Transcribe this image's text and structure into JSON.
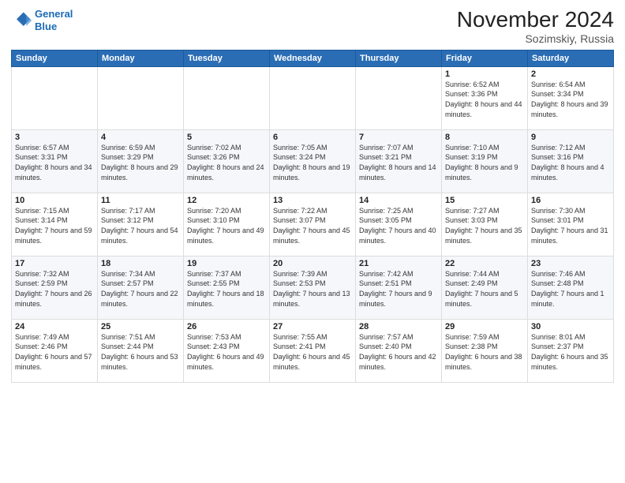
{
  "header": {
    "logo_line1": "General",
    "logo_line2": "Blue",
    "month_title": "November 2024",
    "subtitle": "Sozimskiy, Russia"
  },
  "weekdays": [
    "Sunday",
    "Monday",
    "Tuesday",
    "Wednesday",
    "Thursday",
    "Friday",
    "Saturday"
  ],
  "weeks": [
    [
      {
        "day": "",
        "info": ""
      },
      {
        "day": "",
        "info": ""
      },
      {
        "day": "",
        "info": ""
      },
      {
        "day": "",
        "info": ""
      },
      {
        "day": "",
        "info": ""
      },
      {
        "day": "1",
        "info": "Sunrise: 6:52 AM\nSunset: 3:36 PM\nDaylight: 8 hours and 44 minutes."
      },
      {
        "day": "2",
        "info": "Sunrise: 6:54 AM\nSunset: 3:34 PM\nDaylight: 8 hours and 39 minutes."
      }
    ],
    [
      {
        "day": "3",
        "info": "Sunrise: 6:57 AM\nSunset: 3:31 PM\nDaylight: 8 hours and 34 minutes."
      },
      {
        "day": "4",
        "info": "Sunrise: 6:59 AM\nSunset: 3:29 PM\nDaylight: 8 hours and 29 minutes."
      },
      {
        "day": "5",
        "info": "Sunrise: 7:02 AM\nSunset: 3:26 PM\nDaylight: 8 hours and 24 minutes."
      },
      {
        "day": "6",
        "info": "Sunrise: 7:05 AM\nSunset: 3:24 PM\nDaylight: 8 hours and 19 minutes."
      },
      {
        "day": "7",
        "info": "Sunrise: 7:07 AM\nSunset: 3:21 PM\nDaylight: 8 hours and 14 minutes."
      },
      {
        "day": "8",
        "info": "Sunrise: 7:10 AM\nSunset: 3:19 PM\nDaylight: 8 hours and 9 minutes."
      },
      {
        "day": "9",
        "info": "Sunrise: 7:12 AM\nSunset: 3:16 PM\nDaylight: 8 hours and 4 minutes."
      }
    ],
    [
      {
        "day": "10",
        "info": "Sunrise: 7:15 AM\nSunset: 3:14 PM\nDaylight: 7 hours and 59 minutes."
      },
      {
        "day": "11",
        "info": "Sunrise: 7:17 AM\nSunset: 3:12 PM\nDaylight: 7 hours and 54 minutes."
      },
      {
        "day": "12",
        "info": "Sunrise: 7:20 AM\nSunset: 3:10 PM\nDaylight: 7 hours and 49 minutes."
      },
      {
        "day": "13",
        "info": "Sunrise: 7:22 AM\nSunset: 3:07 PM\nDaylight: 7 hours and 45 minutes."
      },
      {
        "day": "14",
        "info": "Sunrise: 7:25 AM\nSunset: 3:05 PM\nDaylight: 7 hours and 40 minutes."
      },
      {
        "day": "15",
        "info": "Sunrise: 7:27 AM\nSunset: 3:03 PM\nDaylight: 7 hours and 35 minutes."
      },
      {
        "day": "16",
        "info": "Sunrise: 7:30 AM\nSunset: 3:01 PM\nDaylight: 7 hours and 31 minutes."
      }
    ],
    [
      {
        "day": "17",
        "info": "Sunrise: 7:32 AM\nSunset: 2:59 PM\nDaylight: 7 hours and 26 minutes."
      },
      {
        "day": "18",
        "info": "Sunrise: 7:34 AM\nSunset: 2:57 PM\nDaylight: 7 hours and 22 minutes."
      },
      {
        "day": "19",
        "info": "Sunrise: 7:37 AM\nSunset: 2:55 PM\nDaylight: 7 hours and 18 minutes."
      },
      {
        "day": "20",
        "info": "Sunrise: 7:39 AM\nSunset: 2:53 PM\nDaylight: 7 hours and 13 minutes."
      },
      {
        "day": "21",
        "info": "Sunrise: 7:42 AM\nSunset: 2:51 PM\nDaylight: 7 hours and 9 minutes."
      },
      {
        "day": "22",
        "info": "Sunrise: 7:44 AM\nSunset: 2:49 PM\nDaylight: 7 hours and 5 minutes."
      },
      {
        "day": "23",
        "info": "Sunrise: 7:46 AM\nSunset: 2:48 PM\nDaylight: 7 hours and 1 minute."
      }
    ],
    [
      {
        "day": "24",
        "info": "Sunrise: 7:49 AM\nSunset: 2:46 PM\nDaylight: 6 hours and 57 minutes."
      },
      {
        "day": "25",
        "info": "Sunrise: 7:51 AM\nSunset: 2:44 PM\nDaylight: 6 hours and 53 minutes."
      },
      {
        "day": "26",
        "info": "Sunrise: 7:53 AM\nSunset: 2:43 PM\nDaylight: 6 hours and 49 minutes."
      },
      {
        "day": "27",
        "info": "Sunrise: 7:55 AM\nSunset: 2:41 PM\nDaylight: 6 hours and 45 minutes."
      },
      {
        "day": "28",
        "info": "Sunrise: 7:57 AM\nSunset: 2:40 PM\nDaylight: 6 hours and 42 minutes."
      },
      {
        "day": "29",
        "info": "Sunrise: 7:59 AM\nSunset: 2:38 PM\nDaylight: 6 hours and 38 minutes."
      },
      {
        "day": "30",
        "info": "Sunrise: 8:01 AM\nSunset: 2:37 PM\nDaylight: 6 hours and 35 minutes."
      }
    ]
  ]
}
